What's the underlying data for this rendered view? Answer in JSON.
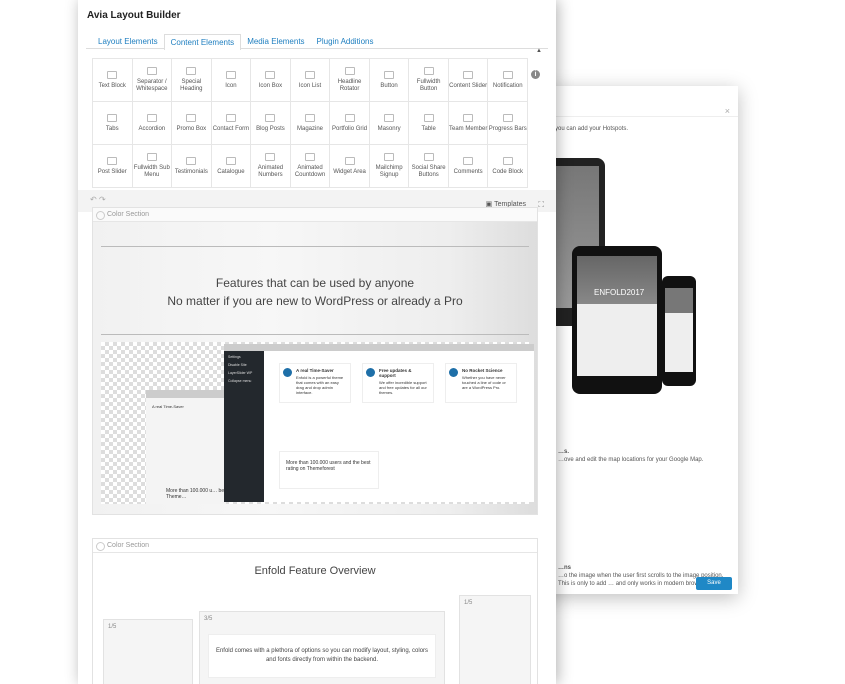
{
  "hotspot_modal": {
    "close": "×",
    "hint": "…d you can add your Hotspots.",
    "device_brand": "ENFOLD2017",
    "maps_title": "…s.",
    "maps_text": "…ove and edit the map locations for your Google Map.",
    "anim_title": "…ns",
    "anim_text": "…o the image when the user first scrolls to the image position. This is only to add … and only works in modern browsers",
    "save_label": "Save"
  },
  "builder": {
    "title": "Avia Layout Builder",
    "tabs": [
      {
        "label": "Layout Elements"
      },
      {
        "label": "Content Elements",
        "active": true
      },
      {
        "label": "Media Elements"
      },
      {
        "label": "Plugin Additions"
      }
    ],
    "collapse_icon": "▲",
    "info_icon": "i",
    "elements": [
      "Text Block",
      "Separator / Whitespace",
      "Special Heading",
      "Icon",
      "Icon Box",
      "Icon List",
      "Headline Rotator",
      "Button",
      "Fullwidth Button",
      "Content Slider",
      "Notification",
      "Tabs",
      "Accordion",
      "Promo Box",
      "Contact Form",
      "Blog Posts",
      "Magazine",
      "Portfolio Grid",
      "Masonry",
      "Table",
      "Team Member",
      "Progress Bars",
      "Post Slider",
      "Fullwidth Sub Menu",
      "Testimonials",
      "Catalogue",
      "Animated Numbers",
      "Animated Countdown",
      "Widget Area",
      "Mailchimp Signup",
      "Social Share Buttons",
      "Comments",
      "Code Block"
    ],
    "undo": "↶",
    "redo": "↷",
    "templates_label": "Templates",
    "fullscreen_icon": "⛶"
  },
  "section1": {
    "label": "Color Section",
    "heading1": "Features that can be used by anyone",
    "heading2": "No matter if you are new to WordPress or already a Pro",
    "mock_small": {
      "title": "A real Time-Saver",
      "bottom": "More than 100.000 u… best rating on Theme…"
    },
    "sidebar": [
      "Settings",
      "Disable Site",
      "LayerSlider WP",
      "Collapse menu"
    ],
    "features": [
      {
        "title": "A real Time-Saver",
        "text": "Enfold is a powerful theme that comes with an easy drag and drop admin interface."
      },
      {
        "title": "Free updates & support",
        "text": "We offer incredible support and free updates for all our themes."
      },
      {
        "title": "No Rocket Science",
        "text": "Whether you have never touched a line of code or are a WordPress Pro."
      }
    ],
    "users_text": "More than 100.000 users and the best rating on Themeforest"
  },
  "section2": {
    "label": "Color Section",
    "heading": "Enfold Feature Overview",
    "columns": [
      "1/5",
      "3/5",
      "1/5"
    ],
    "body": "Enfold comes with a plethora of options so you can modify layout, styling, colors and fonts directly from within the backend."
  },
  "colors": {
    "accent": "#1f7fc0",
    "save": "#1f88c6",
    "admin_sidebar": "#23282d"
  }
}
